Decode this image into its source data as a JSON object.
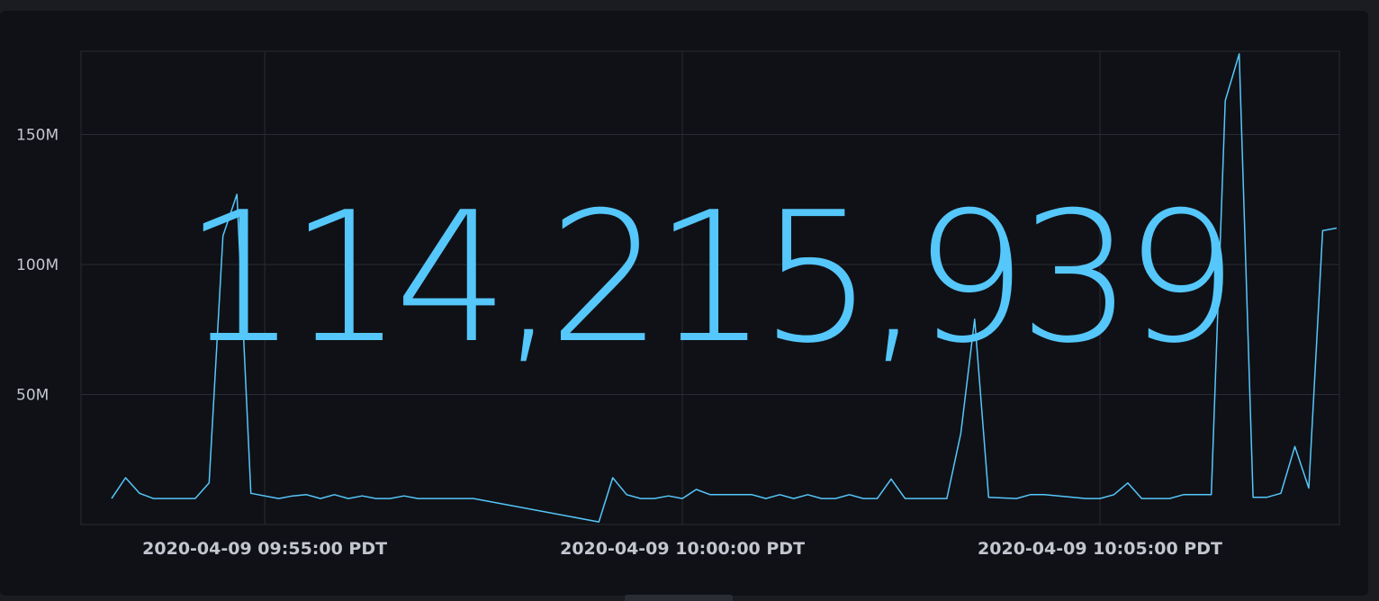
{
  "chart_data": {
    "type": "line",
    "title": "",
    "xlabel": "",
    "ylabel": "",
    "single_stat": "114,215,939",
    "x_ticks": [
      "2020-04-09 09:55:00 PDT",
      "2020-04-09 10:00:00 PDT",
      "2020-04-09 10:05:00 PDT"
    ],
    "y_ticks": [
      "50M",
      "100M",
      "150M"
    ],
    "y_tick_values": [
      50000000,
      100000000,
      150000000
    ],
    "ylim": [
      0,
      182000000
    ],
    "xlim": [
      "2020-04-09 09:52:48 PDT",
      "2020-04-09 10:07:52 PDT"
    ],
    "grid": true,
    "colors": {
      "line": "#55c7fb",
      "value": "#55c7fb",
      "grid": "#2a2c33",
      "background": "#101116"
    },
    "series": [
      {
        "x": [
          "2020-04-09 09:53:10 PDT",
          "2020-04-09 09:53:20 PDT",
          "2020-04-09 09:53:30 PDT",
          "2020-04-09 09:53:40 PDT",
          "2020-04-09 09:54:10 PDT",
          "2020-04-09 09:54:20 PDT",
          "2020-04-09 09:54:30 PDT",
          "2020-04-09 09:54:40 PDT",
          "2020-04-09 09:54:50 PDT",
          "2020-04-09 09:55:10 PDT",
          "2020-04-09 09:55:20 PDT",
          "2020-04-09 09:55:30 PDT",
          "2020-04-09 09:55:40 PDT",
          "2020-04-09 09:55:50 PDT",
          "2020-04-09 09:56:00 PDT",
          "2020-04-09 09:56:10 PDT",
          "2020-04-09 09:56:20 PDT",
          "2020-04-09 09:56:30 PDT",
          "2020-04-09 09:56:40 PDT",
          "2020-04-09 09:56:50 PDT",
          "2020-04-09 09:57:00 PDT",
          "2020-04-09 09:57:30 PDT",
          "2020-04-09 09:59:00 PDT",
          "2020-04-09 09:59:10 PDT",
          "2020-04-09 09:59:20 PDT",
          "2020-04-09 09:59:30 PDT",
          "2020-04-09 09:59:40 PDT",
          "2020-04-09 09:59:50 PDT",
          "2020-04-09 10:00:00 PDT",
          "2020-04-09 10:00:10 PDT",
          "2020-04-09 10:00:20 PDT",
          "2020-04-09 10:00:30 PDT",
          "2020-04-09 10:00:40 PDT",
          "2020-04-09 10:00:50 PDT",
          "2020-04-09 10:01:00 PDT",
          "2020-04-09 10:01:10 PDT",
          "2020-04-09 10:01:20 PDT",
          "2020-04-09 10:01:30 PDT",
          "2020-04-09 10:01:40 PDT",
          "2020-04-09 10:01:50 PDT",
          "2020-04-09 10:02:00 PDT",
          "2020-04-09 10:02:10 PDT",
          "2020-04-09 10:02:20 PDT",
          "2020-04-09 10:02:30 PDT",
          "2020-04-09 10:02:40 PDT",
          "2020-04-09 10:03:10 PDT",
          "2020-04-09 10:03:20 PDT",
          "2020-04-09 10:03:30 PDT",
          "2020-04-09 10:03:40 PDT",
          "2020-04-09 10:04:00 PDT",
          "2020-04-09 10:04:10 PDT",
          "2020-04-09 10:04:20 PDT",
          "2020-04-09 10:04:50 PDT",
          "2020-04-09 10:05:00 PDT",
          "2020-04-09 10:05:10 PDT",
          "2020-04-09 10:05:20 PDT",
          "2020-04-09 10:05:30 PDT",
          "2020-04-09 10:05:50 PDT",
          "2020-04-09 10:06:00 PDT",
          "2020-04-09 10:06:20 PDT",
          "2020-04-09 10:06:30 PDT",
          "2020-04-09 10:06:40 PDT",
          "2020-04-09 10:06:50 PDT",
          "2020-04-09 10:07:00 PDT",
          "2020-04-09 10:07:10 PDT",
          "2020-04-09 10:07:20 PDT",
          "2020-04-09 10:07:30 PDT",
          "2020-04-09 10:07:40 PDT",
          "2020-04-09 10:07:50 PDT"
        ],
        "values": [
          10000000,
          18000000,
          12000000,
          10000000,
          10000000,
          16000000,
          111000000,
          127000000,
          12000000,
          10000000,
          11000000,
          11500000,
          10000000,
          11500000,
          10000000,
          11000000,
          10000000,
          10000000,
          11000000,
          10000000,
          10000000,
          10000000,
          1000000,
          18000000,
          11500000,
          10000000,
          10000000,
          11000000,
          10000000,
          13500000,
          11500000,
          11500000,
          11500000,
          11500000,
          10000000,
          11500000,
          10000000,
          11500000,
          10000000,
          10000000,
          11500000,
          10000000,
          10000000,
          17500000,
          10000000,
          10000000,
          35000000,
          79000000,
          10500000,
          10000000,
          11500000,
          11500000,
          10000000,
          10000000,
          11500000,
          16000000,
          10000000,
          10000000,
          11500000,
          11500000,
          163000000,
          181000000,
          10500000,
          10500000,
          12000000,
          30000000,
          14000000,
          113000000,
          114000000
        ]
      }
    ]
  }
}
